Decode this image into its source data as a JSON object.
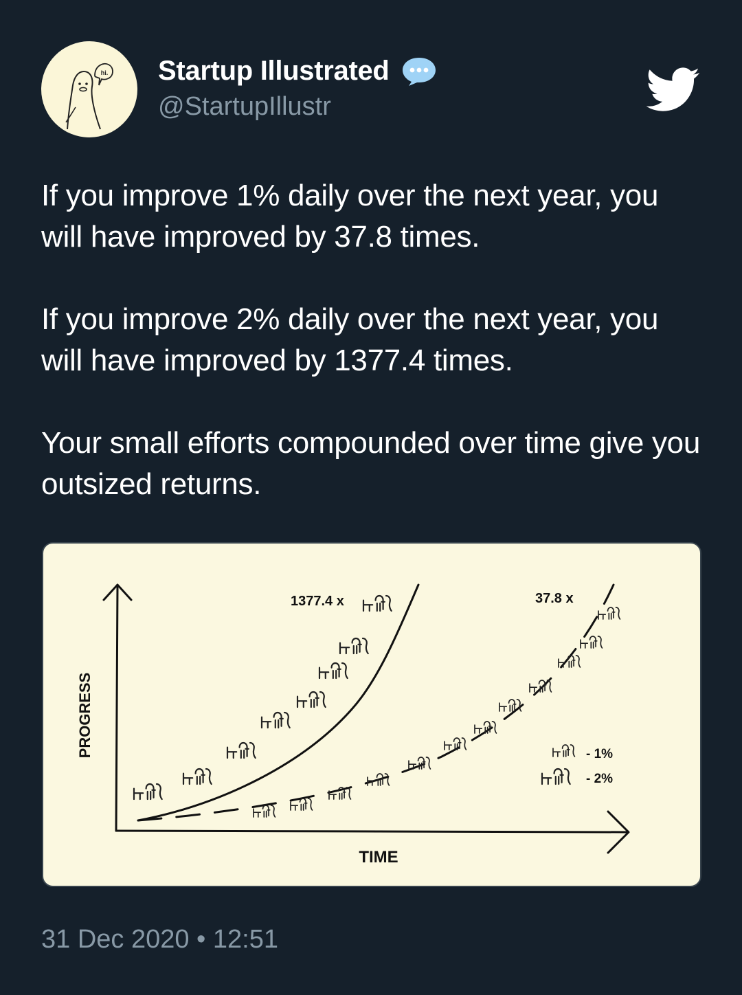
{
  "author": {
    "display_name": "Startup Illustrated",
    "handle": "@StartupIllustr",
    "avatar_speech": "hi."
  },
  "tweet": {
    "paragraphs": [
      "If you improve 1% daily over the next year, you will have improved by 37.8 times.",
      "If you improve 2% daily over the next year, you will have improved by 1377.4 times.",
      "Your small efforts compounded over time give you outsized returns."
    ],
    "timestamp": "31 Dec 2020 • 12:51"
  },
  "icons": {
    "verified": "speech-bubble-icon",
    "brand": "twitter-bird-icon"
  },
  "colors": {
    "background": "#15202b",
    "text": "#ffffff",
    "muted": "#8899a6",
    "verified": "#9fd3f6",
    "media_background": "#fbf8e0"
  },
  "chart_data": {
    "type": "line",
    "xlabel": "TIME",
    "ylabel": "PROGRESS",
    "series": [
      {
        "name": "2%",
        "style": "solid",
        "end_label": "1377.4 x"
      },
      {
        "name": "1%",
        "style": "dashed",
        "end_label": "37.8 x"
      }
    ],
    "legend": [
      {
        "label": "- 1%",
        "series": "1%"
      },
      {
        "label": "- 2%",
        "series": "2%"
      }
    ],
    "legend_position": "bottom-right"
  }
}
